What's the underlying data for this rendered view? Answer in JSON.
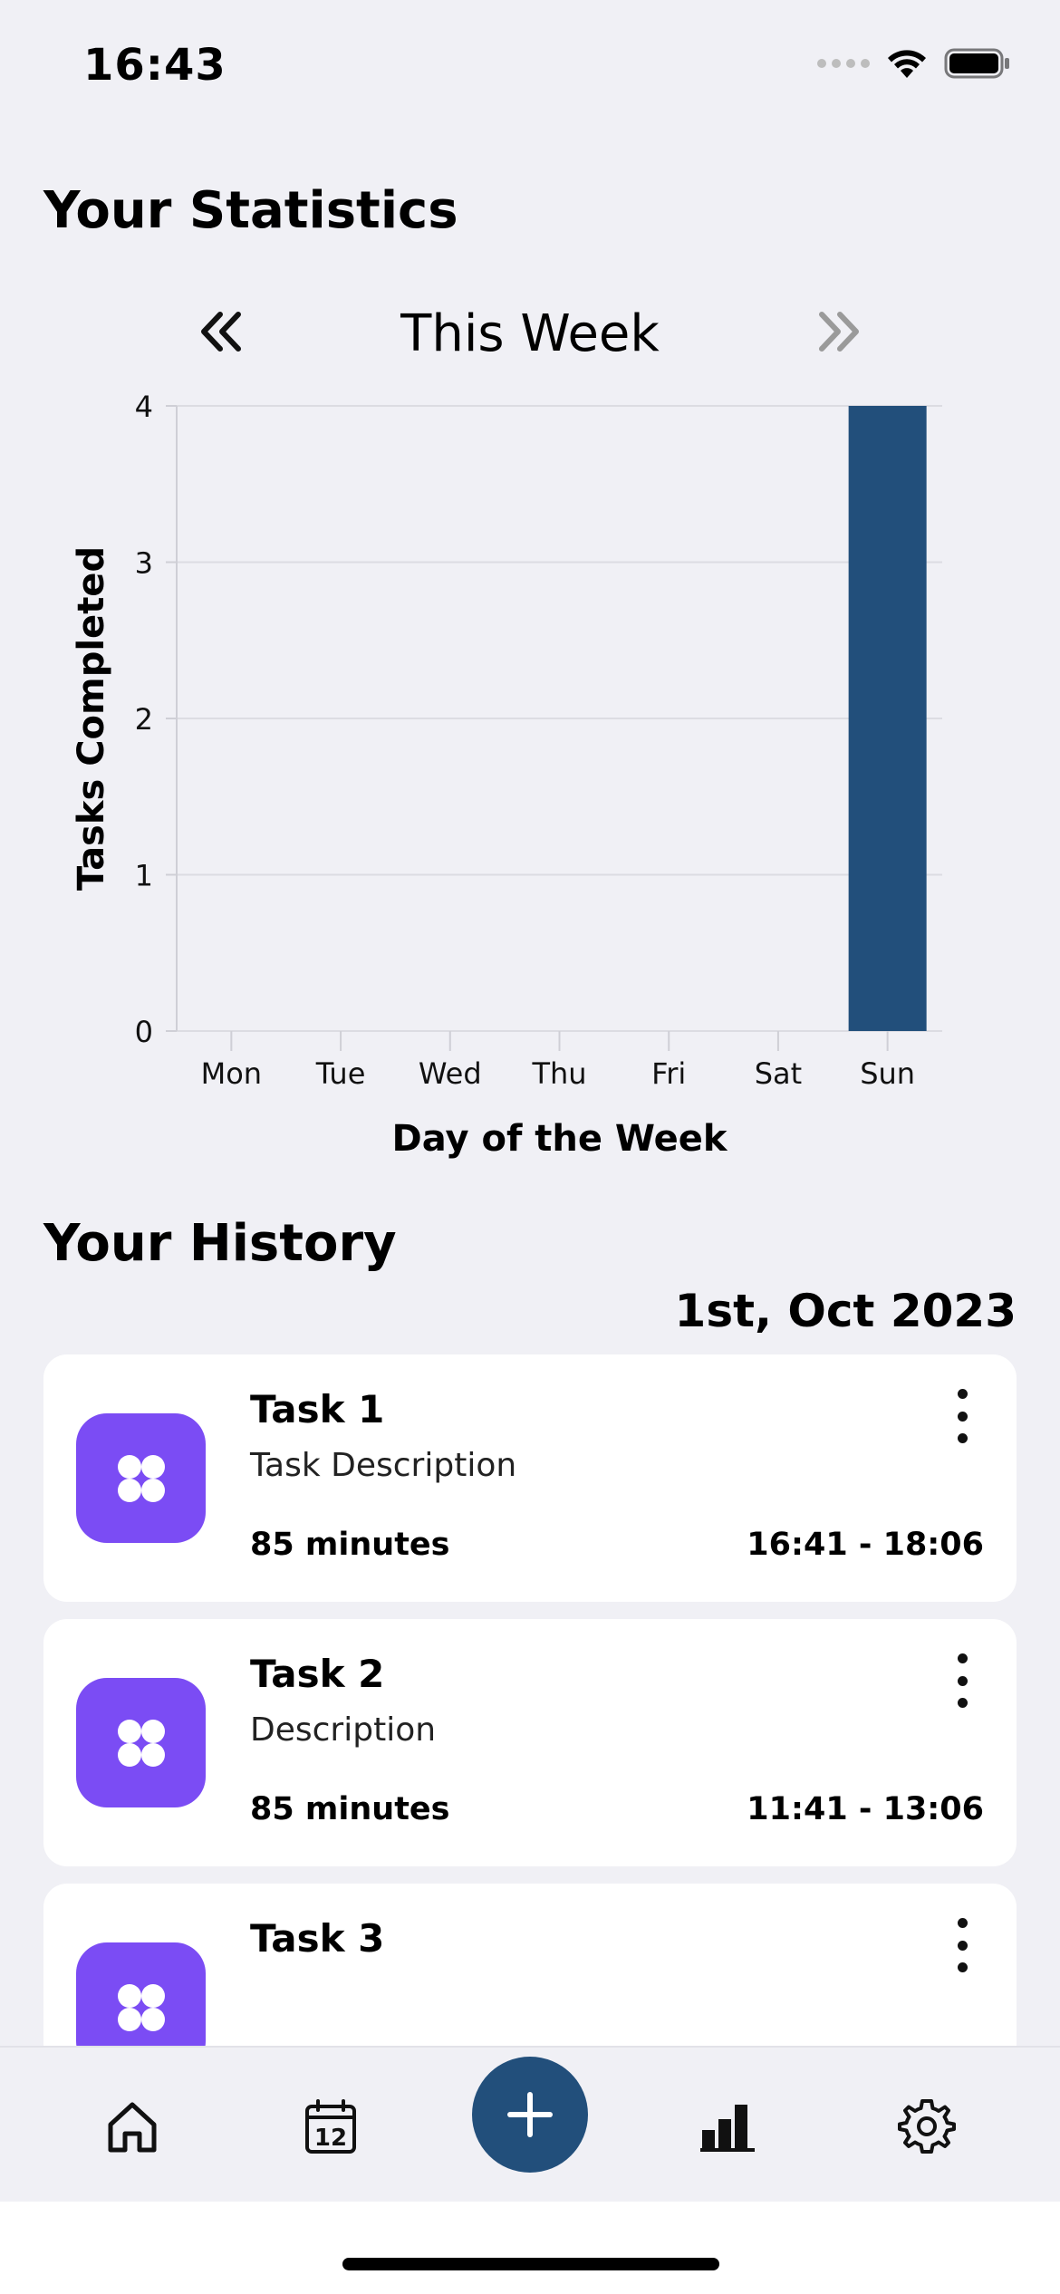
{
  "status_bar": {
    "time": "16:43"
  },
  "stats": {
    "title": "Your Statistics",
    "period_label": "This Week"
  },
  "chart_data": {
    "type": "bar",
    "categories": [
      "Mon",
      "Tue",
      "Wed",
      "Thu",
      "Fri",
      "Sat",
      "Sun"
    ],
    "values": [
      0,
      0,
      0,
      0,
      0,
      0,
      4
    ],
    "yticks": [
      "0",
      "1",
      "2",
      "3",
      "4"
    ],
    "ylim": [
      0,
      4
    ],
    "xlabel": "Day of the Week",
    "ylabel": "Tasks Completed",
    "bar_color": "#224f7b",
    "grid": true
  },
  "history": {
    "title": "Your History",
    "date": "1st, Oct 2023",
    "tasks": [
      {
        "name": "Task 1",
        "description": "Task Description",
        "duration": "85 minutes",
        "time_range": "16:41 - 18:06"
      },
      {
        "name": "Task 2",
        "description": "Description",
        "duration": "85 minutes",
        "time_range": "11:41 - 13:06"
      },
      {
        "name": "Task 3",
        "description": "",
        "duration": "",
        "time_range": ""
      }
    ]
  },
  "tab_bar": {
    "items": [
      "home-icon",
      "calendar-icon",
      "add-icon",
      "stats-icon",
      "settings-icon"
    ],
    "calendar_day": "12"
  },
  "colors": {
    "accent": "#224f7b",
    "task_icon_bg": "#7b4cf4",
    "background": "#f0f0f5"
  }
}
